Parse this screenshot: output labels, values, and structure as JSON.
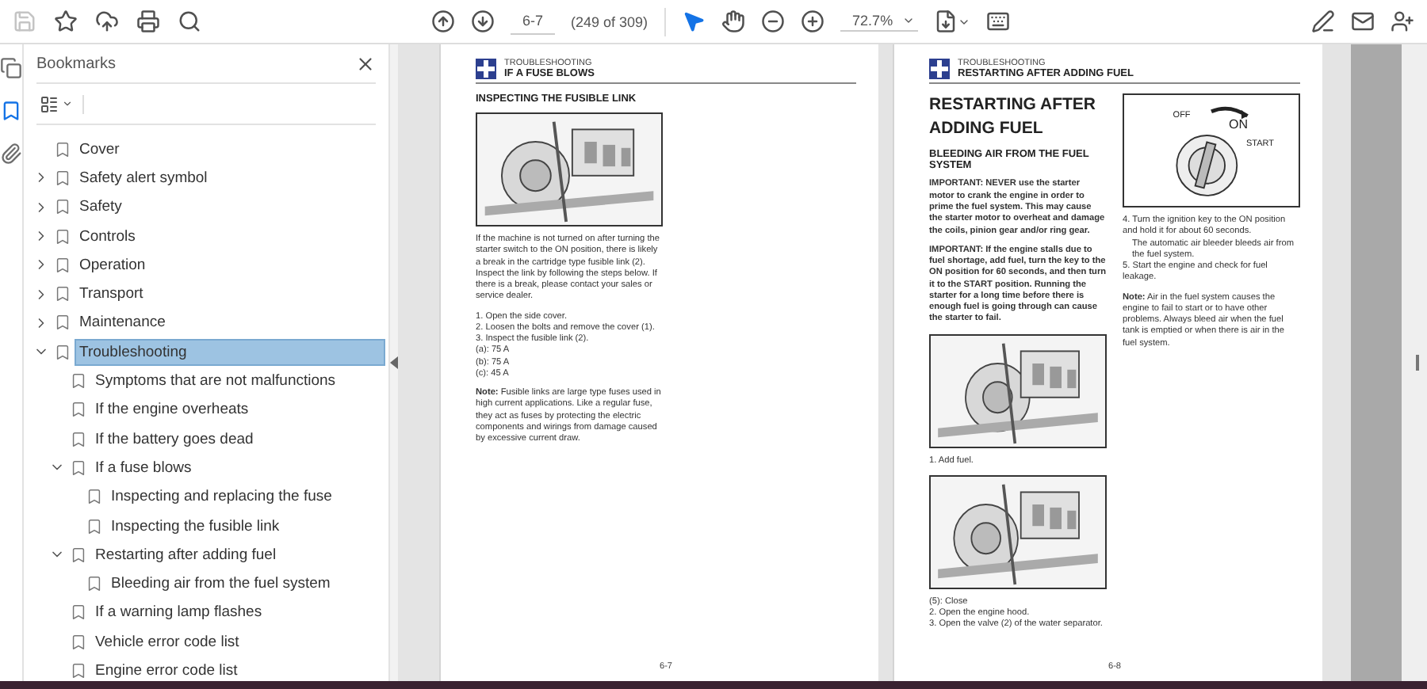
{
  "toolbar": {
    "save": {
      "disabled": true
    },
    "page_field": {
      "value": "6-7"
    },
    "page_count": "(249 of 309)",
    "zoom": {
      "value": "72.7%"
    }
  },
  "rail": [
    {
      "selected": false
    },
    {
      "selected": true
    },
    {
      "selected": false
    }
  ],
  "bookmarks": {
    "title": "Bookmarks",
    "items": [
      {
        "label": "Cover",
        "selected": false
      },
      {
        "label": "Safety alert symbol",
        "expanded": false,
        "selected": false
      },
      {
        "label": "Safety",
        "expanded": false,
        "selected": false
      },
      {
        "label": "Controls",
        "expanded": false,
        "selected": false
      },
      {
        "label": "Operation",
        "expanded": false,
        "selected": false
      },
      {
        "label": "Transport",
        "expanded": false,
        "selected": false
      },
      {
        "label": "Maintenance",
        "expanded": false,
        "selected": false
      },
      {
        "label": "Troubleshooting",
        "expanded": true,
        "selected": true,
        "children": [
          {
            "label": "Symptoms that are not malfunctions",
            "selected": false
          },
          {
            "label": "If the engine overheats",
            "selected": false
          },
          {
            "label": "If the battery goes dead",
            "selected": false
          },
          {
            "label": "If a fuse blows",
            "expanded": true,
            "selected": false,
            "children": [
              {
                "label": "Inspecting and replacing the fuse",
                "selected": false
              },
              {
                "label": "Inspecting the fusible link",
                "selected": false
              }
            ]
          },
          {
            "label": "Restarting after adding fuel",
            "expanded": true,
            "selected": false,
            "children": [
              {
                "label": "Bleeding air from the fuel system",
                "selected": false
              }
            ]
          },
          {
            "label": "If a warning lamp flashes",
            "selected": false
          },
          {
            "label": "Vehicle error code list",
            "selected": false
          },
          {
            "label": "Engine error code list",
            "selected": false
          }
        ]
      }
    ]
  },
  "pages": [
    {
      "header": {
        "section": "TROUBLESHOOTING",
        "title": "IF A FUSE BLOWS"
      },
      "page_number": "6-7",
      "columns": [
        [
          {
            "kind": "heading",
            "text": "INSPECTING THE FUSIBLE LINK"
          },
          {
            "kind": "figure"
          },
          {
            "kind": "paragraph",
            "text": "If the machine is not turned on after turning the starter switch to the ON position, there is likely a break in the cartridge type fusible link (2). Inspect the link by following the steps below. If there is a break, please contact your sales or service dealer."
          },
          {
            "kind": "list",
            "lines": [
              "1. Open the side cover.",
              "2. Loosen the bolts and remove the cover (1).",
              "3. Inspect the fusible link (2).",
              "(a): 75 A",
              "(b): 75 A",
              "(c): 45 A"
            ]
          },
          {
            "kind": "paragraph",
            "text": "**Note:** Fusible links are large type fuses used in high current applications. Like a regular fuse, they act as fuses by protecting the electric components and wirings from damage caused by excessive current draw."
          }
        ]
      ]
    },
    {
      "header": {
        "section": "TROUBLESHOOTING",
        "title": "RESTARTING AFTER ADDING FUEL"
      },
      "page_number": "6-8",
      "columns": [
        [
          {
            "kind": "title",
            "text": "RESTARTING AFTER ADDING FUEL"
          },
          {
            "kind": "heading",
            "text": "BLEEDING AIR FROM THE FUEL SYSTEM"
          },
          {
            "kind": "important",
            "text": "IMPORTANT: NEVER use the starter motor to crank the engine in order to prime the fuel system. This may cause the starter motor to overheat and damage the coils, pinion gear and/or ring gear."
          },
          {
            "kind": "important",
            "text": "IMPORTANT: If the engine stalls due to fuel shortage, add fuel, turn the key to the ON position for 60 seconds, and then turn it to the START position. Running the starter for a long time before there is enough fuel is going through can cause the starter to fail."
          },
          {
            "kind": "figure"
          },
          {
            "kind": "list",
            "lines": [
              "1. Add fuel."
            ]
          },
          {
            "kind": "figure"
          },
          {
            "kind": "list",
            "lines": [
              "(5): Close",
              "2. Open the engine hood.",
              "3. Open the valve (2) of the water separator."
            ]
          }
        ],
        [
          {
            "kind": "key_figure",
            "labels": [
              "OFF",
              "ON",
              "START"
            ]
          },
          {
            "kind": "list",
            "lines": [
              "4. Turn the ignition key to the ON position and hold it for about 60 seconds.",
              "5. Start the engine and check for fuel leakage."
            ],
            "sublines": {
              "0": "The automatic air bleeder bleeds air from the fuel system."
            }
          },
          {
            "kind": "paragraph",
            "text": "**Note:** Air in the fuel system causes the engine to fail to start or to have other problems. Always bleed air when the fuel tank is emptied or when there is air in the fuel system."
          }
        ]
      ]
    }
  ]
}
